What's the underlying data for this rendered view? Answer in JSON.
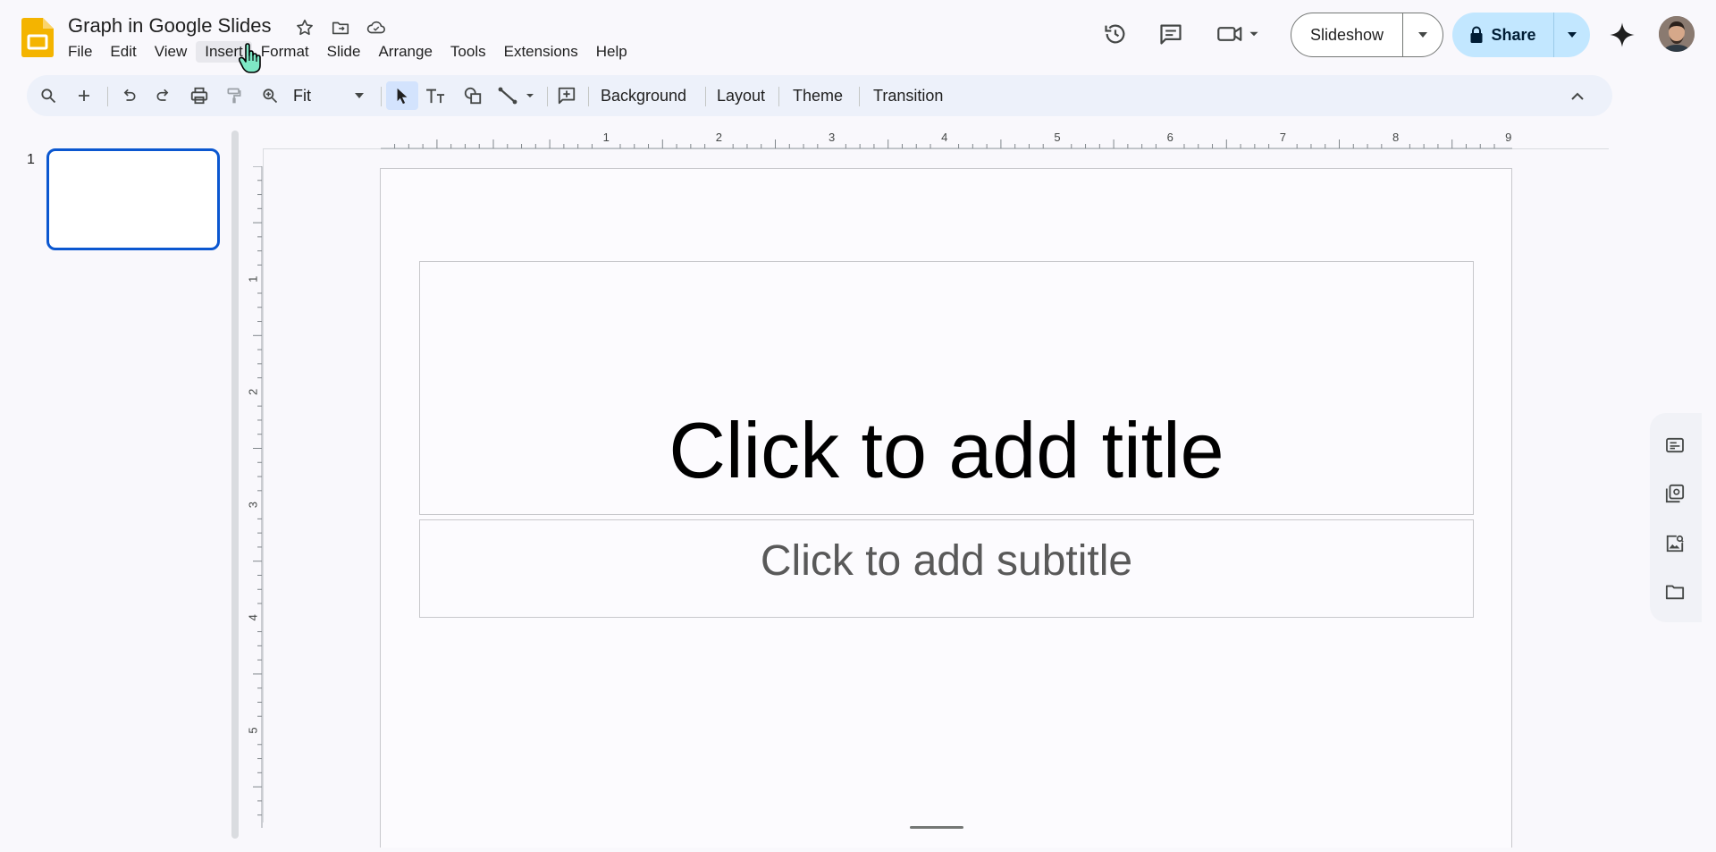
{
  "header": {
    "doc_title": "Graph in Google Slides",
    "menu": [
      "File",
      "Edit",
      "View",
      "Insert",
      "Format",
      "Slide",
      "Arrange",
      "Tools",
      "Extensions",
      "Help"
    ],
    "slideshow_label": "Slideshow",
    "share_label": "Share"
  },
  "toolbar": {
    "zoom_value": "Fit",
    "background_label": "Background",
    "layout_label": "Layout",
    "theme_label": "Theme",
    "transition_label": "Transition"
  },
  "filmstrip": {
    "slide_number": "1"
  },
  "slide": {
    "title_placeholder": "Click to add title",
    "subtitle_placeholder": "Click to add subtitle"
  },
  "rulers": {
    "horizontal_labels": [
      "1",
      "2",
      "3",
      "4",
      "5",
      "6",
      "7",
      "8",
      "9"
    ],
    "vertical_labels": [
      "1",
      "2",
      "3",
      "4",
      "5"
    ]
  },
  "colors": {
    "accent": "#0b57d0",
    "share_bg": "#c2e7ff",
    "logo": "#f4b400"
  }
}
